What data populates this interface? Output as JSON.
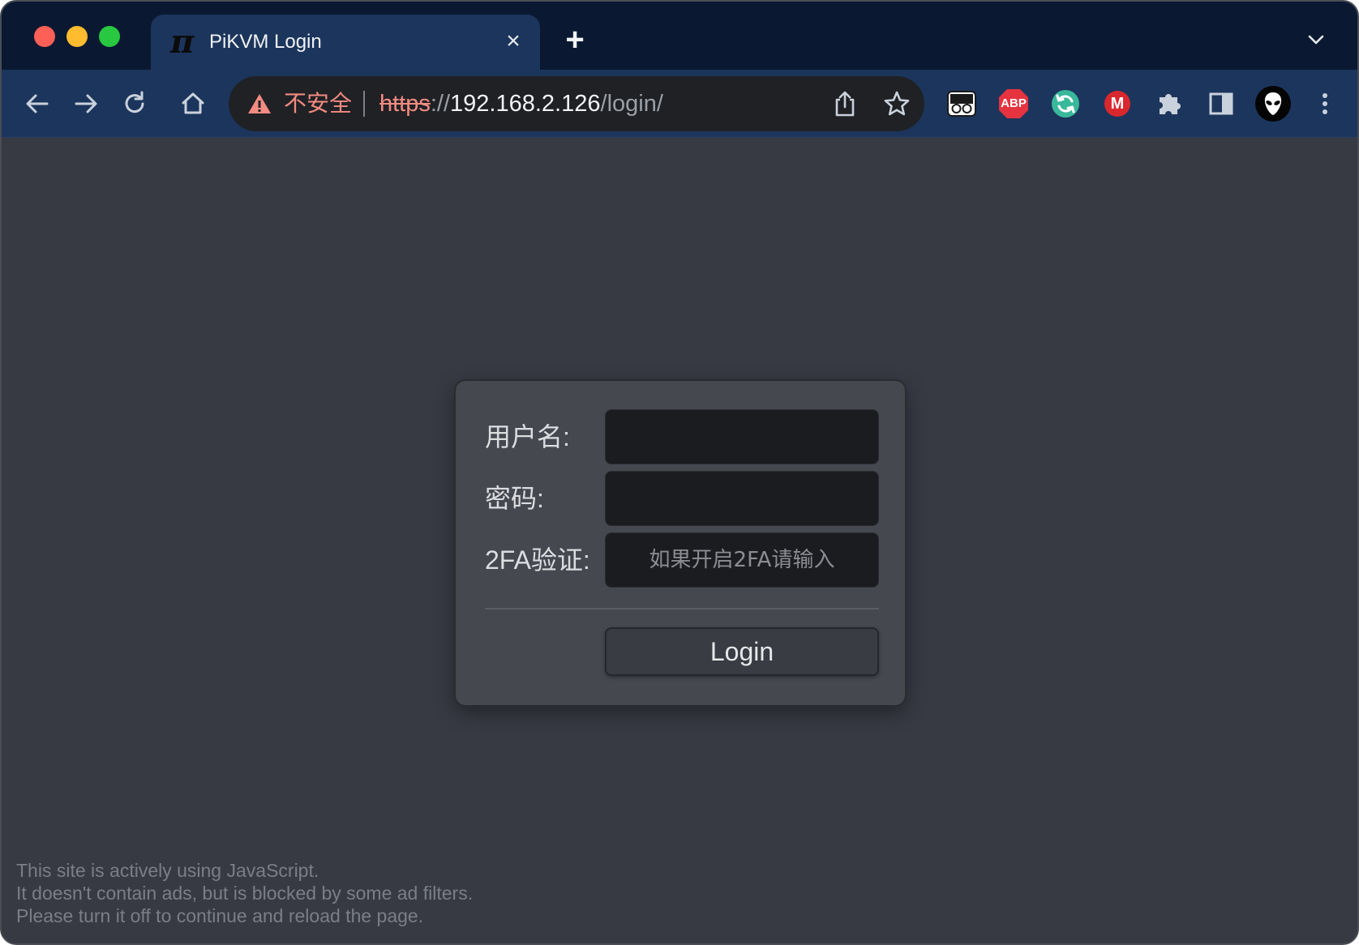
{
  "browser": {
    "tab": {
      "title": "PiKVM Login",
      "favicon_glyph": "π",
      "close_glyph": "×"
    },
    "new_tab_glyph": "+",
    "address_bar": {
      "security_label": "不安全",
      "url_scheme": "https",
      "url_separator": "://",
      "url_host": "192.168.2.126",
      "url_path": "/login/"
    },
    "extensions": [
      "reader-glasses-icon",
      "adblock-plus-icon",
      "sync-icon",
      "mega-icon",
      "puzzle-icon",
      "side-panel-icon",
      "profile-alien-icon",
      "more-vert-icon"
    ],
    "ext_label_abp": "ABP",
    "ext_label_mega": "M"
  },
  "login": {
    "username_label": "用户名:",
    "username_value": "",
    "password_label": "密码:",
    "password_value": "",
    "twofa_label": "2FA验证:",
    "twofa_placeholder": "如果开启2FA请输入",
    "login_button": "Login"
  },
  "notice": {
    "line1": "This site is actively using JavaScript.",
    "line2": "It doesn't contain ads, but is blocked by some ad filters.",
    "line3": "Please turn it off to continue and reload the page."
  },
  "colors": {
    "tabstrip": "#0a1931",
    "toolbar": "#1c355c",
    "page_bg": "#373a43",
    "insecure": "#f28b82"
  }
}
